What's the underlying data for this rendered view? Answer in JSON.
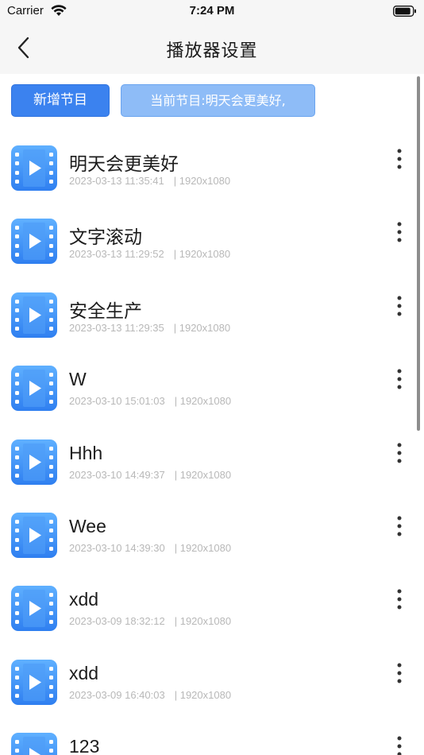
{
  "status_bar": {
    "carrier": "Carrier",
    "time": "7:24 PM",
    "icons": [
      "wifi-icon",
      "battery-icon"
    ]
  },
  "nav": {
    "back_icon": "chevron-left-icon",
    "title": "播放器设置"
  },
  "actions": {
    "add_label": "新增节目",
    "current_label": "当前节目:明天会更美好,"
  },
  "colors": {
    "primary": "#3b82ef",
    "primary_light": "#8ebcf7",
    "icon_gradient_top": "#5fb0ff",
    "icon_gradient_bottom": "#2f7ff0",
    "meta_text": "#b8b8b8"
  },
  "programs": [
    {
      "title": "明天会更美好",
      "date": "2023-03-13 11:35:41",
      "resolution": "| 1920x1080"
    },
    {
      "title": "文字滚动",
      "date": "2023-03-13 11:29:52",
      "resolution": "| 1920x1080"
    },
    {
      "title": "安全生产",
      "date": "2023-03-13 11:29:35",
      "resolution": "| 1920x1080"
    },
    {
      "title": "W",
      "date": "2023-03-10 15:01:03",
      "resolution": "| 1920x1080"
    },
    {
      "title": "Hhh",
      "date": "2023-03-10 14:49:37",
      "resolution": "| 1920x1080"
    },
    {
      "title": "Wee",
      "date": "2023-03-10 14:39:30",
      "resolution": "| 1920x1080"
    },
    {
      "title": "xdd",
      "date": "2023-03-09 18:32:12",
      "resolution": "| 1920x1080"
    },
    {
      "title": "xdd",
      "date": "2023-03-09 16:40:03",
      "resolution": "| 1920x1080"
    },
    {
      "title": "123",
      "date": "",
      "resolution": ""
    }
  ],
  "item_icons": {
    "thumbnail": "video-file-icon",
    "menu": "more-vertical-icon"
  }
}
